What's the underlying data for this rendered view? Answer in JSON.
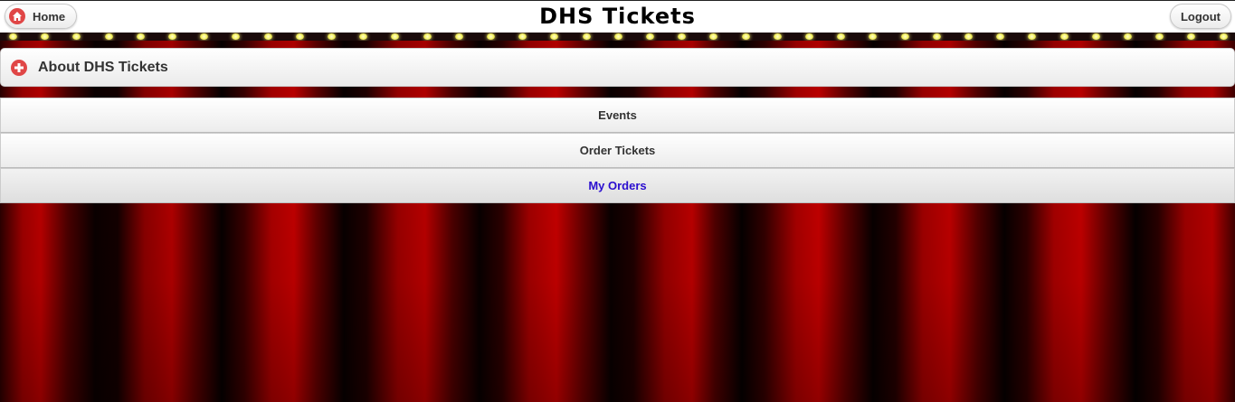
{
  "header": {
    "title": "DHS Tickets",
    "home_label": "Home",
    "logout_label": "Logout"
  },
  "about": {
    "title": "About DHS Tickets"
  },
  "nav": {
    "items": [
      {
        "label": "Events"
      },
      {
        "label": "Order Tickets"
      },
      {
        "label": "My Orders"
      }
    ],
    "active_color": "#2a0ecf"
  },
  "colors": {
    "accent_icon": "#e04646",
    "curtain": "#b00000",
    "bulb": "#f4f060"
  },
  "icons": {
    "home": "home-icon",
    "expand": "plus-icon"
  }
}
